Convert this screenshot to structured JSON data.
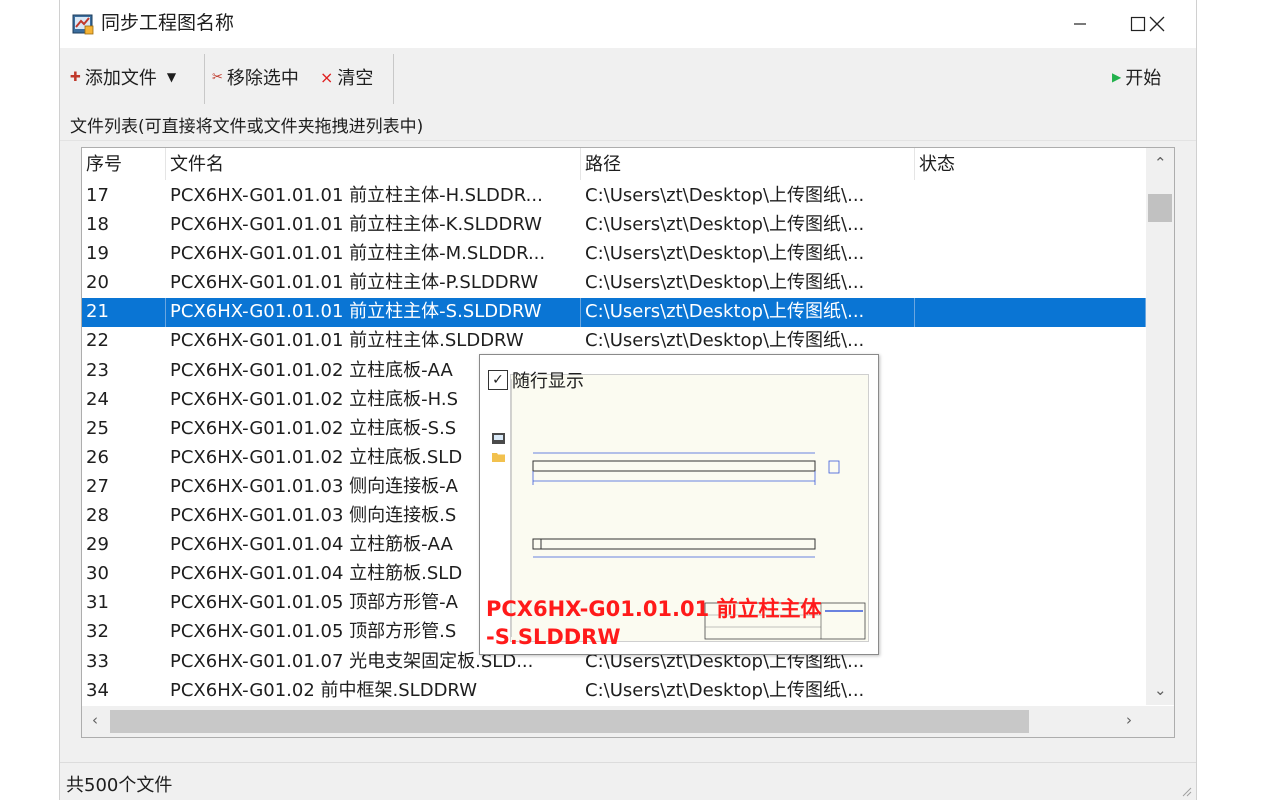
{
  "window": {
    "title": "同步工程图名称",
    "controls": [
      "minimize-icon",
      "maximize-icon",
      "close-icon"
    ]
  },
  "toolbar": {
    "add_files_label": "添加文件",
    "remove_selected_label": "移除选中",
    "clear_label": "清空",
    "start_label": "开始"
  },
  "list_caption": "文件列表(可直接将文件或文件夹拖拽进列表中)",
  "list": {
    "columns": [
      "序号",
      "文件名",
      "路径",
      "状态"
    ],
    "rows": [
      {
        "no": "17",
        "name": "PCX6HX-G01.01.01  前立柱主体-H.SLDDR...",
        "path": "C:\\Users\\zt\\Desktop\\上传图纸\\...",
        "status": ""
      },
      {
        "no": "18",
        "name": "PCX6HX-G01.01.01  前立柱主体-K.SLDDRW",
        "path": "C:\\Users\\zt\\Desktop\\上传图纸\\...",
        "status": ""
      },
      {
        "no": "19",
        "name": "PCX6HX-G01.01.01  前立柱主体-M.SLDDR...",
        "path": "C:\\Users\\zt\\Desktop\\上传图纸\\...",
        "status": ""
      },
      {
        "no": "20",
        "name": "PCX6HX-G01.01.01  前立柱主体-P.SLDDRW",
        "path": "C:\\Users\\zt\\Desktop\\上传图纸\\...",
        "status": ""
      },
      {
        "no": "21",
        "name": "PCX6HX-G01.01.01  前立柱主体-S.SLDDRW",
        "path": "C:\\Users\\zt\\Desktop\\上传图纸\\...",
        "status": "",
        "selected": true
      },
      {
        "no": "22",
        "name": "PCX6HX-G01.01.01  前立柱主体.SLDDRW",
        "path": "C:\\Users\\zt\\Desktop\\上传图纸\\...",
        "status": ""
      },
      {
        "no": "23",
        "name": "PCX6HX-G01.01.02  立柱底板-AA",
        "path": "",
        "status": ""
      },
      {
        "no": "24",
        "name": "PCX6HX-G01.01.02  立柱底板-H.S",
        "path": "",
        "status": ""
      },
      {
        "no": "25",
        "name": "PCX6HX-G01.01.02  立柱底板-S.S",
        "path": "",
        "status": ""
      },
      {
        "no": "26",
        "name": "PCX6HX-G01.01.02  立柱底板.SLD",
        "path": "",
        "status": ""
      },
      {
        "no": "27",
        "name": "PCX6HX-G01.01.03  侧向连接板-A",
        "path": "",
        "status": ""
      },
      {
        "no": "28",
        "name": "PCX6HX-G01.01.03  侧向连接板.S",
        "path": "",
        "status": ""
      },
      {
        "no": "29",
        "name": "PCX6HX-G01.01.04  立柱筋板-AA",
        "path": "",
        "status": ""
      },
      {
        "no": "30",
        "name": "PCX6HX-G01.01.04  立柱筋板.SLD",
        "path": "",
        "status": ""
      },
      {
        "no": "31",
        "name": "PCX6HX-G01.01.05  顶部方形管-A",
        "path": "",
        "status": ""
      },
      {
        "no": "32",
        "name": "PCX6HX-G01.01.05  顶部方形管.S",
        "path": "",
        "status": ""
      },
      {
        "no": "33",
        "name": "PCX6HX-G01.01.07   光电支架固定板.SLD...",
        "path": "C:\\Users\\zt\\Desktop\\上传图纸\\...",
        "status": ""
      },
      {
        "no": "34",
        "name": "PCX6HX-G01.02  前中框架.SLDDRW",
        "path": "C:\\Users\\zt\\Desktop\\上传图纸\\...",
        "status": ""
      }
    ]
  },
  "preview": {
    "checkbox_label": "随行显示",
    "checked": true,
    "caption_line1": "PCX6HX-G01.01.01  前立柱主体",
    "caption_line2": "-S.SLDDRW"
  },
  "status_bar": "共500个文件",
  "colors": {
    "selection": "#0a75d4",
    "window_bg": "#f0f0f0",
    "preview_caption": "#ff1a1a",
    "start_icon": "#22b14c",
    "clear_icon": "#e02020"
  }
}
